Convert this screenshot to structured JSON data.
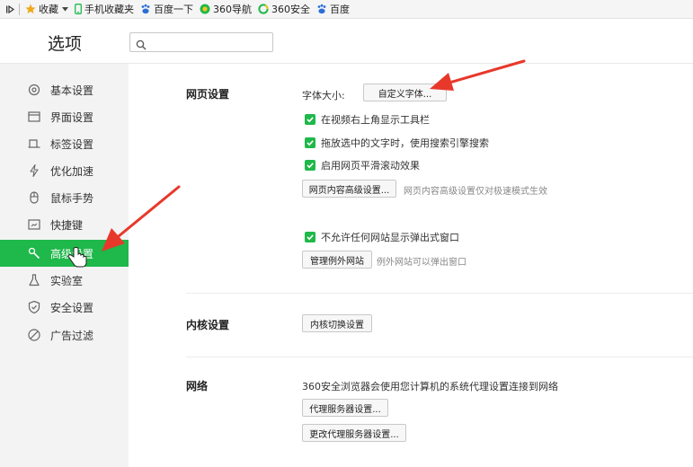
{
  "bookmarks": {
    "items": [
      {
        "label": "收藏",
        "icon": "star-icon"
      },
      {
        "label": "手机收藏夹",
        "icon": "phone-icon"
      },
      {
        "label": "百度一下",
        "icon": "baidu-paw-icon"
      },
      {
        "label": "360导航",
        "icon": "360-nav-icon"
      },
      {
        "label": "360安全",
        "icon": "360-safe-icon"
      },
      {
        "label": "百度",
        "icon": "baidu-paw-icon"
      }
    ]
  },
  "header": {
    "title": "选项",
    "search_placeholder": ""
  },
  "sidebar": {
    "items": [
      {
        "label": "基本设置",
        "icon": "gear-icon",
        "active": false
      },
      {
        "label": "界面设置",
        "icon": "window-icon",
        "active": false
      },
      {
        "label": "标签设置",
        "icon": "tab-icon",
        "active": false
      },
      {
        "label": "优化加速",
        "icon": "lightning-icon",
        "active": false
      },
      {
        "label": "鼠标手势",
        "icon": "mouse-icon",
        "active": false
      },
      {
        "label": "快捷键",
        "icon": "keyboard-icon",
        "active": false
      },
      {
        "label": "高级设置",
        "icon": "wrench-icon",
        "active": true
      },
      {
        "label": "实验室",
        "icon": "flask-icon",
        "active": false
      },
      {
        "label": "安全设置",
        "icon": "shield-icon",
        "active": false
      },
      {
        "label": "广告过滤",
        "icon": "block-icon",
        "active": false
      }
    ]
  },
  "webpage": {
    "title": "网页设置",
    "font_size_label": "字体大小:",
    "custom_font_button": "自定义字体...",
    "checkboxes": [
      {
        "label": "在视频右上角显示工具栏",
        "checked": true
      },
      {
        "label": "拖放选中的文字时，使用搜索引擎搜索",
        "checked": true
      },
      {
        "label": "启用网页平滑滚动效果",
        "checked": true
      }
    ],
    "advanced_button": "网页内容高级设置...",
    "advanced_hint": "网页内容高级设置仅对极速模式生效",
    "popup_checkbox": {
      "label": "不允许任何网站显示弹出式窗口",
      "checked": true
    },
    "exceptions_button": "管理例外网站",
    "exceptions_hint": "例外网站可以弹出窗口"
  },
  "kernel": {
    "title": "内核设置",
    "switch_button": "内核切换设置"
  },
  "network": {
    "title": "网络",
    "description": "360安全浏览器会使用您计算机的系统代理设置连接到网络",
    "proxy_button": "代理服务器设置...",
    "change_proxy_button": "更改代理服务器设置..."
  },
  "colors": {
    "accent": "#1fb84a",
    "arrow": "#e8382b"
  }
}
